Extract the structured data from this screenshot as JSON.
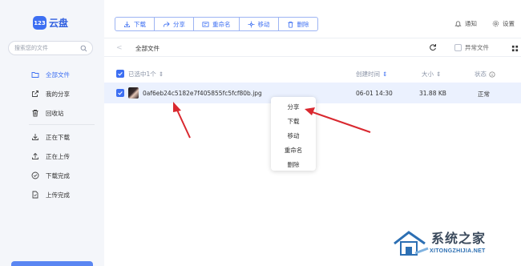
{
  "app": {
    "logo_badge": "123",
    "logo_text": "云盘"
  },
  "sidebar": {
    "search_placeholder": "搜索您的文件",
    "items": [
      {
        "label": "全部文件",
        "icon": "folder-icon",
        "active": true
      },
      {
        "label": "我的分享",
        "icon": "share-icon"
      },
      {
        "label": "回收站",
        "icon": "trash-icon"
      },
      {
        "label": "正在下载",
        "icon": "download-icon"
      },
      {
        "label": "正在上传",
        "icon": "upload-icon"
      },
      {
        "label": "下载完成",
        "icon": "check-circle-icon"
      },
      {
        "label": "上传完成",
        "icon": "file-done-icon"
      }
    ]
  },
  "toolbar": {
    "download": "下载",
    "share": "分享",
    "rename": "重命名",
    "move": "移动",
    "delete": "删除"
  },
  "header": {
    "notify": "通知",
    "settings": "设置"
  },
  "breadcrumb": {
    "title": "全部文件",
    "abnormal_label": "异常文件"
  },
  "table": {
    "selected_label": "已选中1个",
    "col_created": "创建时间",
    "col_size": "大小",
    "col_status": "状态",
    "rows": [
      {
        "name": "0af6eb24c5182e7f405855fc5fcf80b.jpg",
        "created": "06-01 14:30",
        "size": "31.88 KB",
        "status": "正常"
      }
    ]
  },
  "context_menu": {
    "items": [
      "分享",
      "下载",
      "移动",
      "重命名",
      "删除"
    ]
  },
  "watermark": {
    "title": "系统之家",
    "url": "XITONGZHIJIA.NET"
  },
  "colors": {
    "accent": "#3d6ff2",
    "sidebar_bg": "#f4f6fa",
    "row_selected": "#ebf1fe",
    "annotation_arrow": "#d9282f"
  }
}
